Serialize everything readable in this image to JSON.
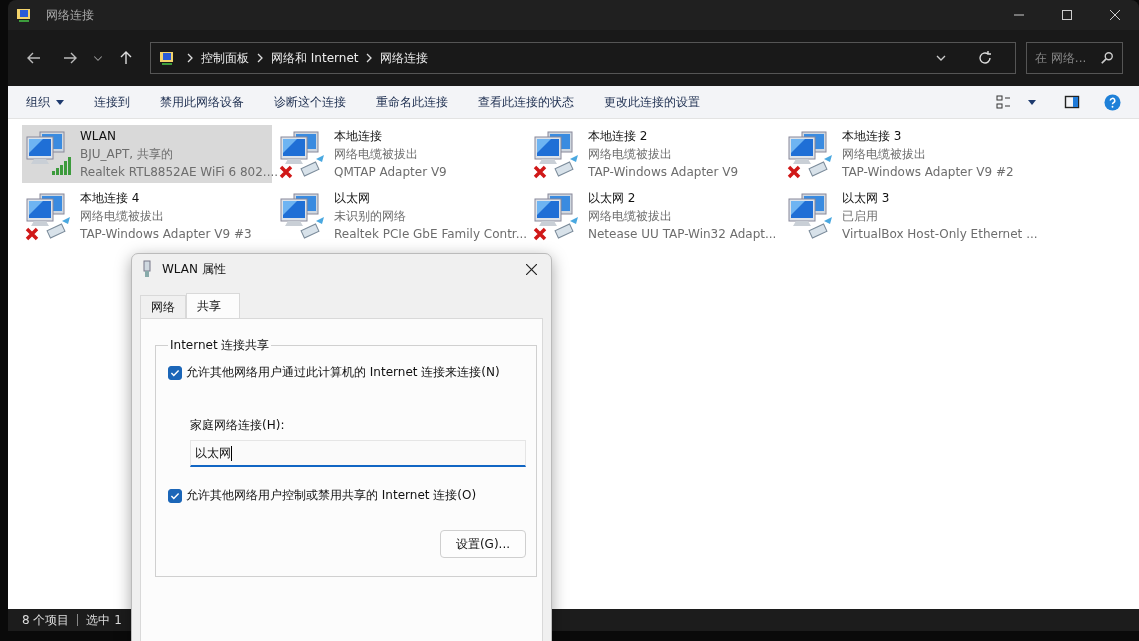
{
  "window": {
    "title": "网络连接"
  },
  "address_bar": {
    "crumbs": [
      "控制面板",
      "网络和 Internet",
      "网络连接"
    ]
  },
  "search": {
    "placeholder": "在 网络..."
  },
  "commands": [
    {
      "label": "组织",
      "dropdown": true
    },
    {
      "label": "连接到",
      "dropdown": false
    },
    {
      "label": "禁用此网络设备",
      "dropdown": false
    },
    {
      "label": "诊断这个连接",
      "dropdown": false
    },
    {
      "label": "重命名此连接",
      "dropdown": false
    },
    {
      "label": "查看此连接的状态",
      "dropdown": false
    },
    {
      "label": "更改此连接的设置",
      "dropdown": false
    }
  ],
  "connections": [
    {
      "name": "WLAN",
      "status": "BJU_APT, 共享的",
      "adapter": "Realtek RTL8852AE WiFi 6 802....",
      "kind": "wifi",
      "selected": true
    },
    {
      "name": "本地连接",
      "status": "网络电缆被拔出",
      "adapter": "QMTAP Adapter V9",
      "kind": "unplugged",
      "selected": false
    },
    {
      "name": "本地连接 2",
      "status": "网络电缆被拔出",
      "adapter": "TAP-Windows Adapter V9",
      "kind": "unplugged",
      "selected": false
    },
    {
      "name": "本地连接 3",
      "status": "网络电缆被拔出",
      "adapter": "TAP-Windows Adapter V9 #2",
      "kind": "unplugged",
      "selected": false
    },
    {
      "name": "本地连接 4",
      "status": "网络电缆被拔出",
      "adapter": "TAP-Windows Adapter V9 #3",
      "kind": "unplugged",
      "selected": false
    },
    {
      "name": "以太网",
      "status": "未识别的网络",
      "adapter": "Realtek PCIe GbE Family Contr...",
      "kind": "wired",
      "selected": false
    },
    {
      "name": "以太网 2",
      "status": "网络电缆被拔出",
      "adapter": "Netease UU TAP-Win32 Adapt...",
      "kind": "unplugged",
      "selected": false
    },
    {
      "name": "以太网 3",
      "status": "已启用",
      "adapter": "VirtualBox Host-Only Ethernet ...",
      "kind": "wired",
      "selected": false
    }
  ],
  "status_bar": {
    "count": "8 个项目",
    "selection": "选中 1"
  },
  "dialog": {
    "title": "WLAN 属性",
    "tabs": [
      {
        "label": "网络",
        "selected": false
      },
      {
        "label": "共享",
        "selected": true
      }
    ],
    "group_title": "Internet 连接共享",
    "allow_sharing": {
      "label": "允许其他网络用户通过此计算机的 Internet 连接来连接(N)",
      "checked": true
    },
    "home_network": {
      "label": "家庭网络连接(H):",
      "value": "以太网"
    },
    "allow_control": {
      "label": "允许其他网络用户控制或禁用共享的 Internet 连接(O)",
      "checked": true
    },
    "settings_button": "设置(G)..."
  }
}
